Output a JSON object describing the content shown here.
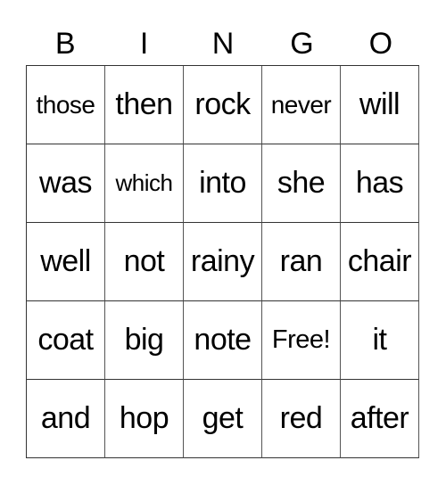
{
  "header": [
    "B",
    "I",
    "N",
    "G",
    "O"
  ],
  "rows": [
    [
      "those",
      "then",
      "rock",
      "never",
      "will"
    ],
    [
      "was",
      "which",
      "into",
      "she",
      "has"
    ],
    [
      "well",
      "not",
      "rainy",
      "ran",
      "chair"
    ],
    [
      "coat",
      "big",
      "note",
      "Free!",
      "it"
    ],
    [
      "and",
      "hop",
      "get",
      "red",
      "after"
    ]
  ]
}
